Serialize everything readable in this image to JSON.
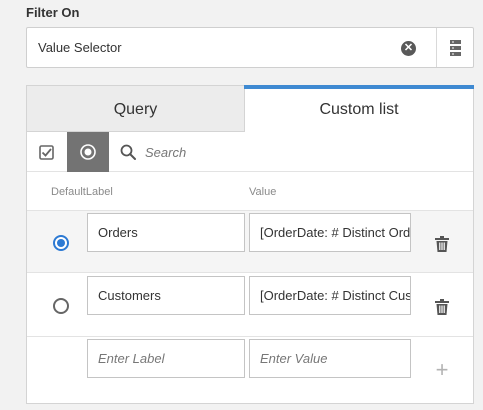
{
  "section": {
    "title": "Filter On"
  },
  "filter": {
    "value": "Value Selector",
    "clear_icon": "clear-icon",
    "database_icon": "database-icon"
  },
  "tabs": [
    {
      "label": "Query",
      "active": false
    },
    {
      "label": "Custom list",
      "active": true
    }
  ],
  "toolbar": {
    "search_placeholder": "Search"
  },
  "columns": {
    "default_label": "DefaultLabel",
    "value": "Value"
  },
  "rows": [
    {
      "label": "Orders",
      "value": "[OrderDate: # Distinct Orders]",
      "selected": true
    },
    {
      "label": "Customers",
      "value": "[OrderDate: # Distinct Customers]",
      "selected": false
    }
  ],
  "new_row": {
    "label_placeholder": "Enter Label",
    "value_placeholder": "Enter Value"
  },
  "colors": {
    "accent": "#3f8ad2",
    "radio_selected": "#2d7ad3",
    "toolbar_active": "#737373"
  }
}
